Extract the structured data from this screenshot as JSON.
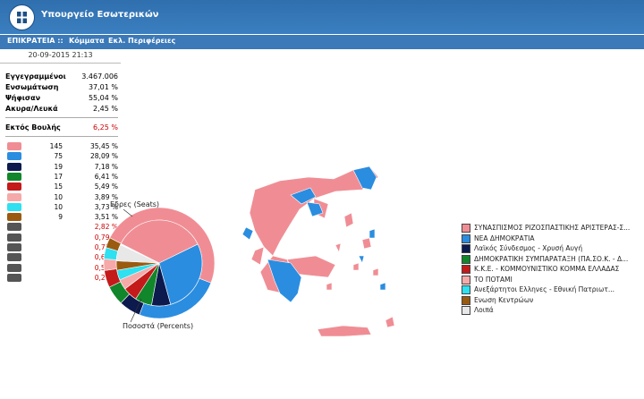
{
  "header": {
    "title": "Υπουργείο Εσωτερικών"
  },
  "nav": {
    "items": [
      "ΕΠΙΚΡΑΤΕΙΑ ::",
      "Κόμματα",
      "Εκλ. Περιφέρειες"
    ]
  },
  "datetime": "20-09-2015 21:13",
  "stats": [
    {
      "label": "Εγγεγραμμένοι",
      "value": "3.467.006"
    },
    {
      "label": "Ενσωμάτωση",
      "value": "37,01 %"
    },
    {
      "label": "Ψήφισαν",
      "value": "55,04 %"
    },
    {
      "label": "Ακυρα/Λευκά",
      "value": "2,45 %"
    },
    {
      "label": "Εκτός Βουλής",
      "value": "6,25 %"
    }
  ],
  "parties": [
    {
      "logo": "syriza-logo",
      "seats": "145",
      "pct": "35,45 %",
      "color": "#f08d94"
    },
    {
      "logo": "nd-logo",
      "seats": "75",
      "pct": "28,09 %",
      "color": "#2a8de0"
    },
    {
      "logo": "xa-logo",
      "seats": "19",
      "pct": "7,18 %",
      "color": "#0c1a4e"
    },
    {
      "logo": "pasok-logo",
      "seats": "17",
      "pct": "6,41 %",
      "color": "#12862a"
    },
    {
      "logo": "kke-logo",
      "seats": "15",
      "pct": "5,49 %",
      "color": "#c41a1a"
    },
    {
      "logo": "potami-logo",
      "seats": "10",
      "pct": "3,89 %",
      "color": "#f5a9a9"
    },
    {
      "logo": "anel-logo",
      "seats": "10",
      "pct": "3,73 %",
      "color": "#2ee0f0"
    },
    {
      "logo": "ek-logo",
      "seats": "9",
      "pct": "3,51 %",
      "color": "#9a5a10"
    },
    {
      "logo": "laae-logo",
      "seats": "",
      "pct": "2,82 %",
      "color": "#555"
    },
    {
      "logo": "antarsya-logo",
      "seats": "",
      "pct": "0,79 %",
      "color": "#555"
    },
    {
      "logo": "kkeml-logo",
      "seats": "",
      "pct": "0,73 %",
      "color": "#555"
    },
    {
      "logo": "koinonia-logo",
      "seats": "",
      "pct": "0,68 %",
      "color": "#555"
    },
    {
      "logo": "party-logo",
      "seats": "",
      "pct": "0,52 %",
      "color": "#555"
    },
    {
      "logo": "party-logo-2",
      "seats": "",
      "pct": "0,27 %",
      "color": "#555"
    }
  ],
  "chart_labels": {
    "seats": "Εδρες (Seats)",
    "percents": "Ποσοστά (Percents)"
  },
  "chart_data": {
    "type": "pie",
    "rings": [
      {
        "name": "Εδρες (Seats)",
        "values": [
          145,
          75,
          19,
          17,
          15,
          10,
          10,
          9
        ]
      },
      {
        "name": "Ποσοστά (Percents)",
        "values": [
          35.45,
          28.09,
          7.18,
          6.41,
          5.49,
          3.89,
          3.73,
          3.51,
          6.25
        ]
      }
    ],
    "colors": [
      "#f08d94",
      "#2a8de0",
      "#0c1a4e",
      "#12862a",
      "#c41a1a",
      "#f5a9a9",
      "#2ee0f0",
      "#9a5a10",
      "#e8e8e8"
    ]
  },
  "legend": [
    {
      "label": "ΣΥΝΑΣΠΙΣΜΟΣ ΡΙΖΟΣΠΑΣΤΙΚΗΣ ΑΡΙΣΤΕΡΑΣ-Σ...",
      "color": "#f08d94"
    },
    {
      "label": "ΝΕΑ ΔΗΜΟΚΡΑΤΙΑ",
      "color": "#2a8de0"
    },
    {
      "label": "Λαϊκός Σύνδεσμος - Χρυσή Αυγή",
      "color": "#0c1a4e"
    },
    {
      "label": "ΔΗΜΟΚΡΑΤΙΚΗ ΣΥΜΠΑΡΑΤΑΞΗ (ΠΑ.ΣΟ.Κ. - Δ...",
      "color": "#12862a"
    },
    {
      "label": "Κ.Κ.Ε. - ΚΟΜΜΟΥΝΙΣΤΙΚΟ ΚΟΜΜΑ ΕΛΛΑΔΑΣ",
      "color": "#c41a1a"
    },
    {
      "label": "ΤΟ ΠΟΤΑΜΙ",
      "color": "#f5a9a9"
    },
    {
      "label": "Ανεξάρτητοι Ελληνες - Εθνική Πατριωτ...",
      "color": "#2ee0f0"
    },
    {
      "label": "Ενωση Κεντρώων",
      "color": "#9a5a10"
    },
    {
      "label": "Λοιπά",
      "color": "#e8e8e8"
    }
  ],
  "map": {
    "colors": {
      "syriza": "#f08d94",
      "nd": "#2a8de0"
    }
  }
}
